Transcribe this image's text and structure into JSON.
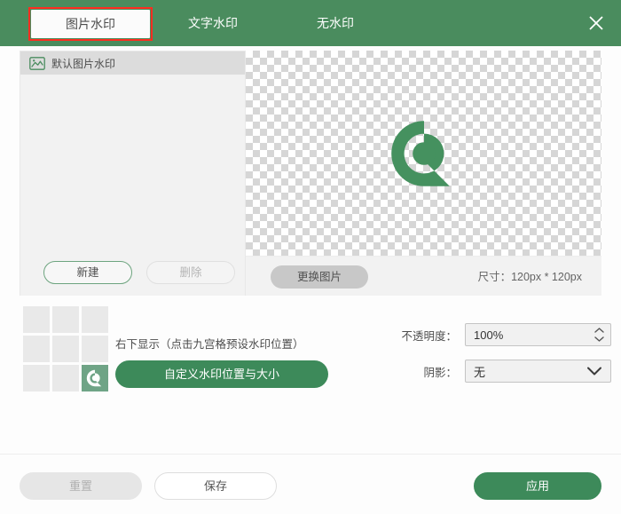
{
  "header": {
    "tabs": [
      {
        "id": "image-watermark",
        "label": "图片水印",
        "active": true
      },
      {
        "id": "text-watermark",
        "label": "文字水印",
        "active": false
      },
      {
        "id": "no-watermark",
        "label": "无水印",
        "active": false
      }
    ],
    "close_icon": "close-icon",
    "accent_color": "#4a8c5e",
    "highlight_color": "#ff2d20"
  },
  "list_panel": {
    "items": [
      {
        "label": "默认图片水印",
        "icon": "picture-icon",
        "selected": true
      }
    ],
    "new_label": "新建",
    "delete_label": "删除"
  },
  "preview": {
    "logo_icon": "brand-logo-icon",
    "replace_label": "更换图片",
    "size_label": "尺寸：120px * 120px"
  },
  "position": {
    "grid_cells": [
      {
        "index": 0,
        "selected": false
      },
      {
        "index": 1,
        "selected": false
      },
      {
        "index": 2,
        "selected": false
      },
      {
        "index": 3,
        "selected": false
      },
      {
        "index": 4,
        "selected": false
      },
      {
        "index": 5,
        "selected": false
      },
      {
        "index": 6,
        "selected": false
      },
      {
        "index": 7,
        "selected": false
      },
      {
        "index": 8,
        "selected": true
      }
    ],
    "description": "右下显示（点击九宫格预设水印位置）",
    "custom_label": "自定义水印位置与大小"
  },
  "fields": {
    "opacity": {
      "label": "不透明度：",
      "value": "100%"
    },
    "shadow": {
      "label": "阴影：",
      "value": "无"
    }
  },
  "footer": {
    "reset_label": "重置",
    "save_label": "保存",
    "apply_label": "应用",
    "apply_color": "#3d8a5a"
  }
}
